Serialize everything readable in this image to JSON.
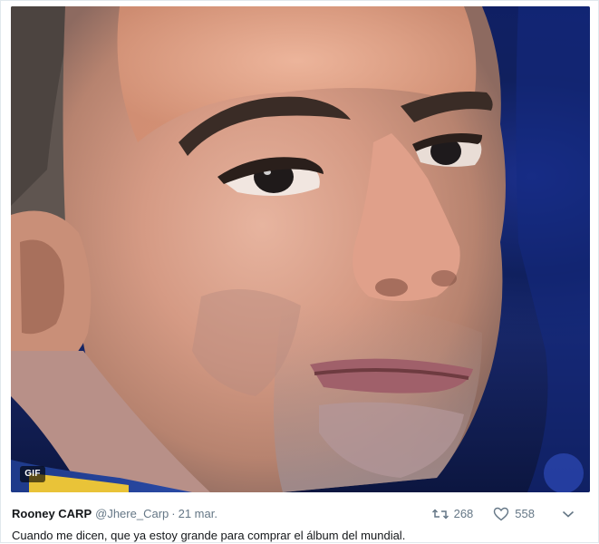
{
  "media": {
    "type_badge": "GIF"
  },
  "tweet": {
    "author_name": "Rooney CARP",
    "handle": "@Jhere_Carp",
    "separator": "·",
    "date": "21 mar.",
    "text": "Cuando me dicen, que ya estoy grande para comprar el álbum del mundial.",
    "retweet_count": "268",
    "like_count": "558"
  },
  "icons": {
    "retweet": "retweet-icon",
    "like": "heart-icon",
    "more": "chevron-down-icon"
  },
  "colors": {
    "text": "#14171a",
    "secondary": "#657786",
    "border": "#e1e8ed",
    "background": "#ffffff"
  }
}
